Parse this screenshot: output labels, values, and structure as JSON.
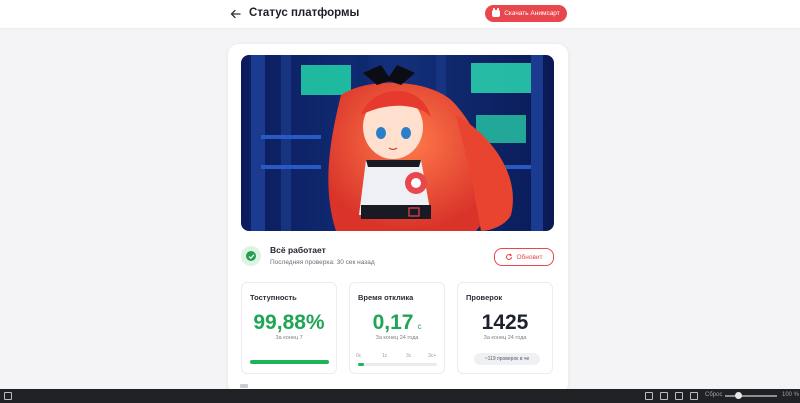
{
  "header": {
    "title": "Статус платформы",
    "download_label": "Скачать Анимсарт"
  },
  "status": {
    "title": "Всё работает",
    "subtitle": "Последняя проверка: 30 сек назад",
    "refresh_label": "Обновит"
  },
  "stats": {
    "availability": {
      "label": "Тоступность",
      "value": "99,88%",
      "sub": "За конец 7",
      "progress": 0.9988
    },
    "response": {
      "label": "Время отклика",
      "value": "0,17",
      "unit": "с",
      "sub": "За конец 24 года",
      "ticks": [
        "0с",
        "1с",
        "3с",
        "3с+"
      ],
      "level": 0.07
    },
    "checks": {
      "label": "Проверок",
      "value": "1425",
      "sub": "За конец 24 года",
      "badge": "~119 проверок в чe"
    }
  },
  "taskbar": {
    "reset_label": "Сброс",
    "zoom": "100 %"
  },
  "colors": {
    "accent": "#e8484d",
    "success": "#1fa555"
  }
}
